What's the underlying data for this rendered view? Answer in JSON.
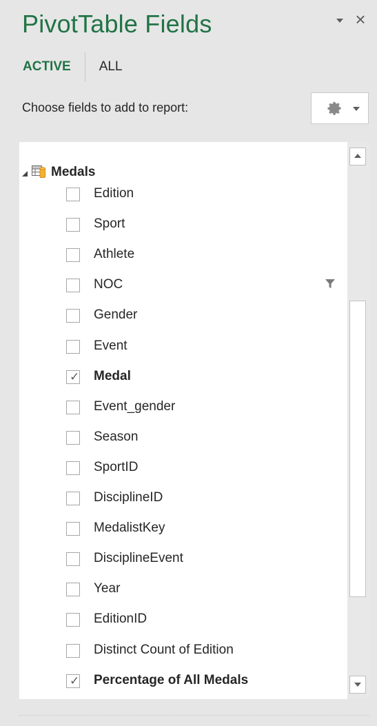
{
  "pane": {
    "title": "PivotTable Fields"
  },
  "tabs": {
    "active": "ACTIVE",
    "all": "ALL"
  },
  "choose_label": "Choose fields to add to report:",
  "table": {
    "name": "Medals"
  },
  "fields": [
    {
      "label": "Edition",
      "checked": false,
      "bold": false
    },
    {
      "label": "Sport",
      "checked": false,
      "bold": false
    },
    {
      "label": "Athlete",
      "checked": false,
      "bold": false
    },
    {
      "label": "NOC",
      "checked": false,
      "bold": false,
      "filtered": true
    },
    {
      "label": "Gender",
      "checked": false,
      "bold": false
    },
    {
      "label": "Event",
      "checked": false,
      "bold": false
    },
    {
      "label": "Medal",
      "checked": true,
      "bold": true
    },
    {
      "label": "Event_gender",
      "checked": false,
      "bold": false
    },
    {
      "label": "Season",
      "checked": false,
      "bold": false
    },
    {
      "label": "SportID",
      "checked": false,
      "bold": false
    },
    {
      "label": "DisciplineID",
      "checked": false,
      "bold": false
    },
    {
      "label": "MedalistKey",
      "checked": false,
      "bold": false
    },
    {
      "label": "DisciplineEvent",
      "checked": false,
      "bold": false
    },
    {
      "label": "Year",
      "checked": false,
      "bold": false
    },
    {
      "label": "EditionID",
      "checked": false,
      "bold": false
    },
    {
      "label": "Distinct Count of Edition",
      "checked": false,
      "bold": false
    },
    {
      "label": "Percentage of All Medals",
      "checked": true,
      "bold": true
    }
  ],
  "colors": {
    "accent": "#217346",
    "panel_bg": "#e6e6e6",
    "list_bg": "#ffffff"
  }
}
